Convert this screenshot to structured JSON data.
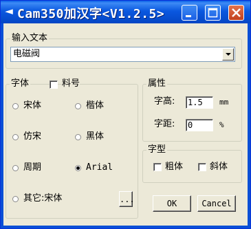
{
  "window": {
    "title": "Cam350加汉字<V1.2.5>"
  },
  "input_text": {
    "legend": "输入文本",
    "value": "电磁阀"
  },
  "font": {
    "legend": "字体",
    "size_label": "料号",
    "options": [
      "宋体",
      "楷体",
      "仿宋",
      "黑体",
      "周期",
      "Arial",
      "其它:宋体"
    ],
    "selected": "Arial",
    "browse_label": "..."
  },
  "properties": {
    "legend": "属性",
    "height_label": "字高:",
    "height_value": "1.5",
    "height_unit": "mm",
    "spacing_label": "字距:",
    "spacing_value": "0",
    "spacing_unit": "%"
  },
  "style": {
    "legend": "字型",
    "bold_label": "粗体",
    "italic_label": "斜体"
  },
  "buttons": {
    "ok": "OK",
    "cancel": "Cancel"
  }
}
